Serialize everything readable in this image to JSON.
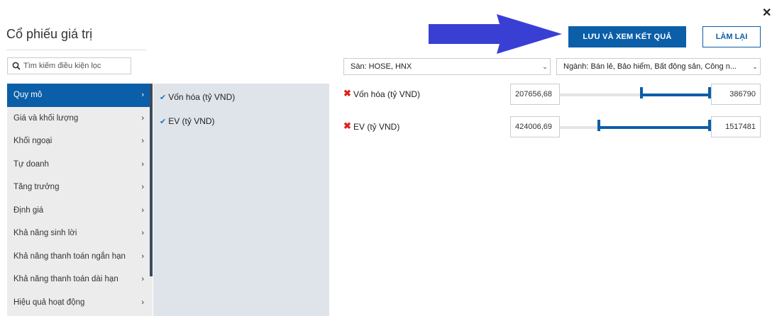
{
  "header": {
    "title": "Cổ phiếu giá trị",
    "close_icon": "close-icon",
    "save_button": "LƯU VÀ XEM KẾT QUẢ",
    "reset_button": "LÀM LẠI",
    "accent_color": "#0b5ea8",
    "arrow_color": "#3a3fd4"
  },
  "search": {
    "placeholder": "Tìm kiếm điều kiện lọc",
    "icon": "search-icon"
  },
  "filters": {
    "exchange": "Sàn: HOSE, HNX",
    "industry": "Ngành: Bán lẻ, Bảo hiểm, Bất động sản, Công n..."
  },
  "sidebar": {
    "items": [
      {
        "label": "Quy mô",
        "active": true
      },
      {
        "label": "Giá và khối lượng"
      },
      {
        "label": "Khối ngoại"
      },
      {
        "label": "Tự doanh"
      },
      {
        "label": "Tăng trưởng"
      },
      {
        "label": "Định giá"
      },
      {
        "label": "Khả năng sinh lời"
      },
      {
        "label": "Khả năng thanh toán ngắn hạn"
      },
      {
        "label": "Khả năng thanh toán dài hạn"
      },
      {
        "label": "Hiệu quả hoạt động"
      }
    ],
    "chevron": "›"
  },
  "subpanel": {
    "items": [
      {
        "label": "Vốn hóa (tỷ VND)",
        "checked": true
      },
      {
        "label": "EV (tỷ VND)",
        "checked": true
      }
    ]
  },
  "criteria": [
    {
      "name": "Vốn hóa (tỷ VND)",
      "min": "207656,68",
      "max": "386790",
      "range_start": 0.53,
      "range_end": 1.0
    },
    {
      "name": "EV (tỷ VND)",
      "min": "424006,69",
      "max": "1517481",
      "range_start": 0.25,
      "range_end": 1.0
    }
  ]
}
